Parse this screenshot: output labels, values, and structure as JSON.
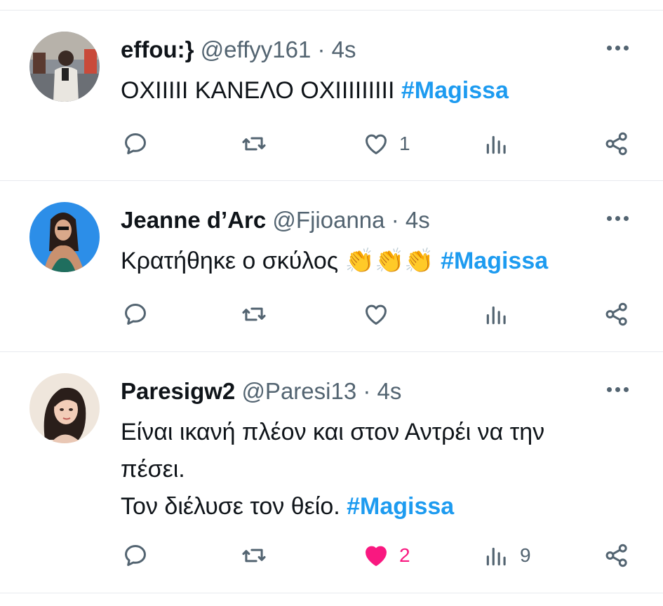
{
  "colors": {
    "accent": "#1d9bf0",
    "like": "#f91880",
    "muted": "#536471",
    "text": "#0f1419"
  },
  "tweets": [
    {
      "name": "effou:}",
      "handle": "@effyy161",
      "sep": "·",
      "time": "4s",
      "text_lines": [
        "ΟΧΙΙΙΙΙ ΚΑΝΕΛΟ ΟΧΙΙΙΙΙΙΙΙΙ "
      ],
      "hashtag": "#Magissa",
      "replies": "",
      "retweets": "",
      "likes": "1",
      "views": "",
      "liked": false
    },
    {
      "name": "Jeanne d’Arc",
      "handle": "@Fjioanna",
      "sep": "·",
      "time": "4s",
      "text_lines": [
        "Κρατήθηκε ο σκύλος "
      ],
      "emoji": "👏👏👏",
      "hashtag": "#Magissa",
      "replies": "",
      "retweets": "",
      "likes": "",
      "views": "",
      "liked": false
    },
    {
      "name": "Paresigw2",
      "handle": "@Paresi13",
      "sep": "·",
      "time": "4s",
      "text_lines": [
        "Είναι ικανή πλέον και στον Αντρέι να την",
        "πέσει.",
        "Τον διέλυσε τον θείο. "
      ],
      "hashtag": "#Magissa",
      "replies": "",
      "retweets": "",
      "likes": "2",
      "views": "9",
      "liked": true
    }
  ],
  "icons": {
    "reply": "reply-icon",
    "retweet": "retweet-icon",
    "like": "heart-icon",
    "views": "views-icon",
    "share": "share-icon",
    "more": "more-icon"
  }
}
